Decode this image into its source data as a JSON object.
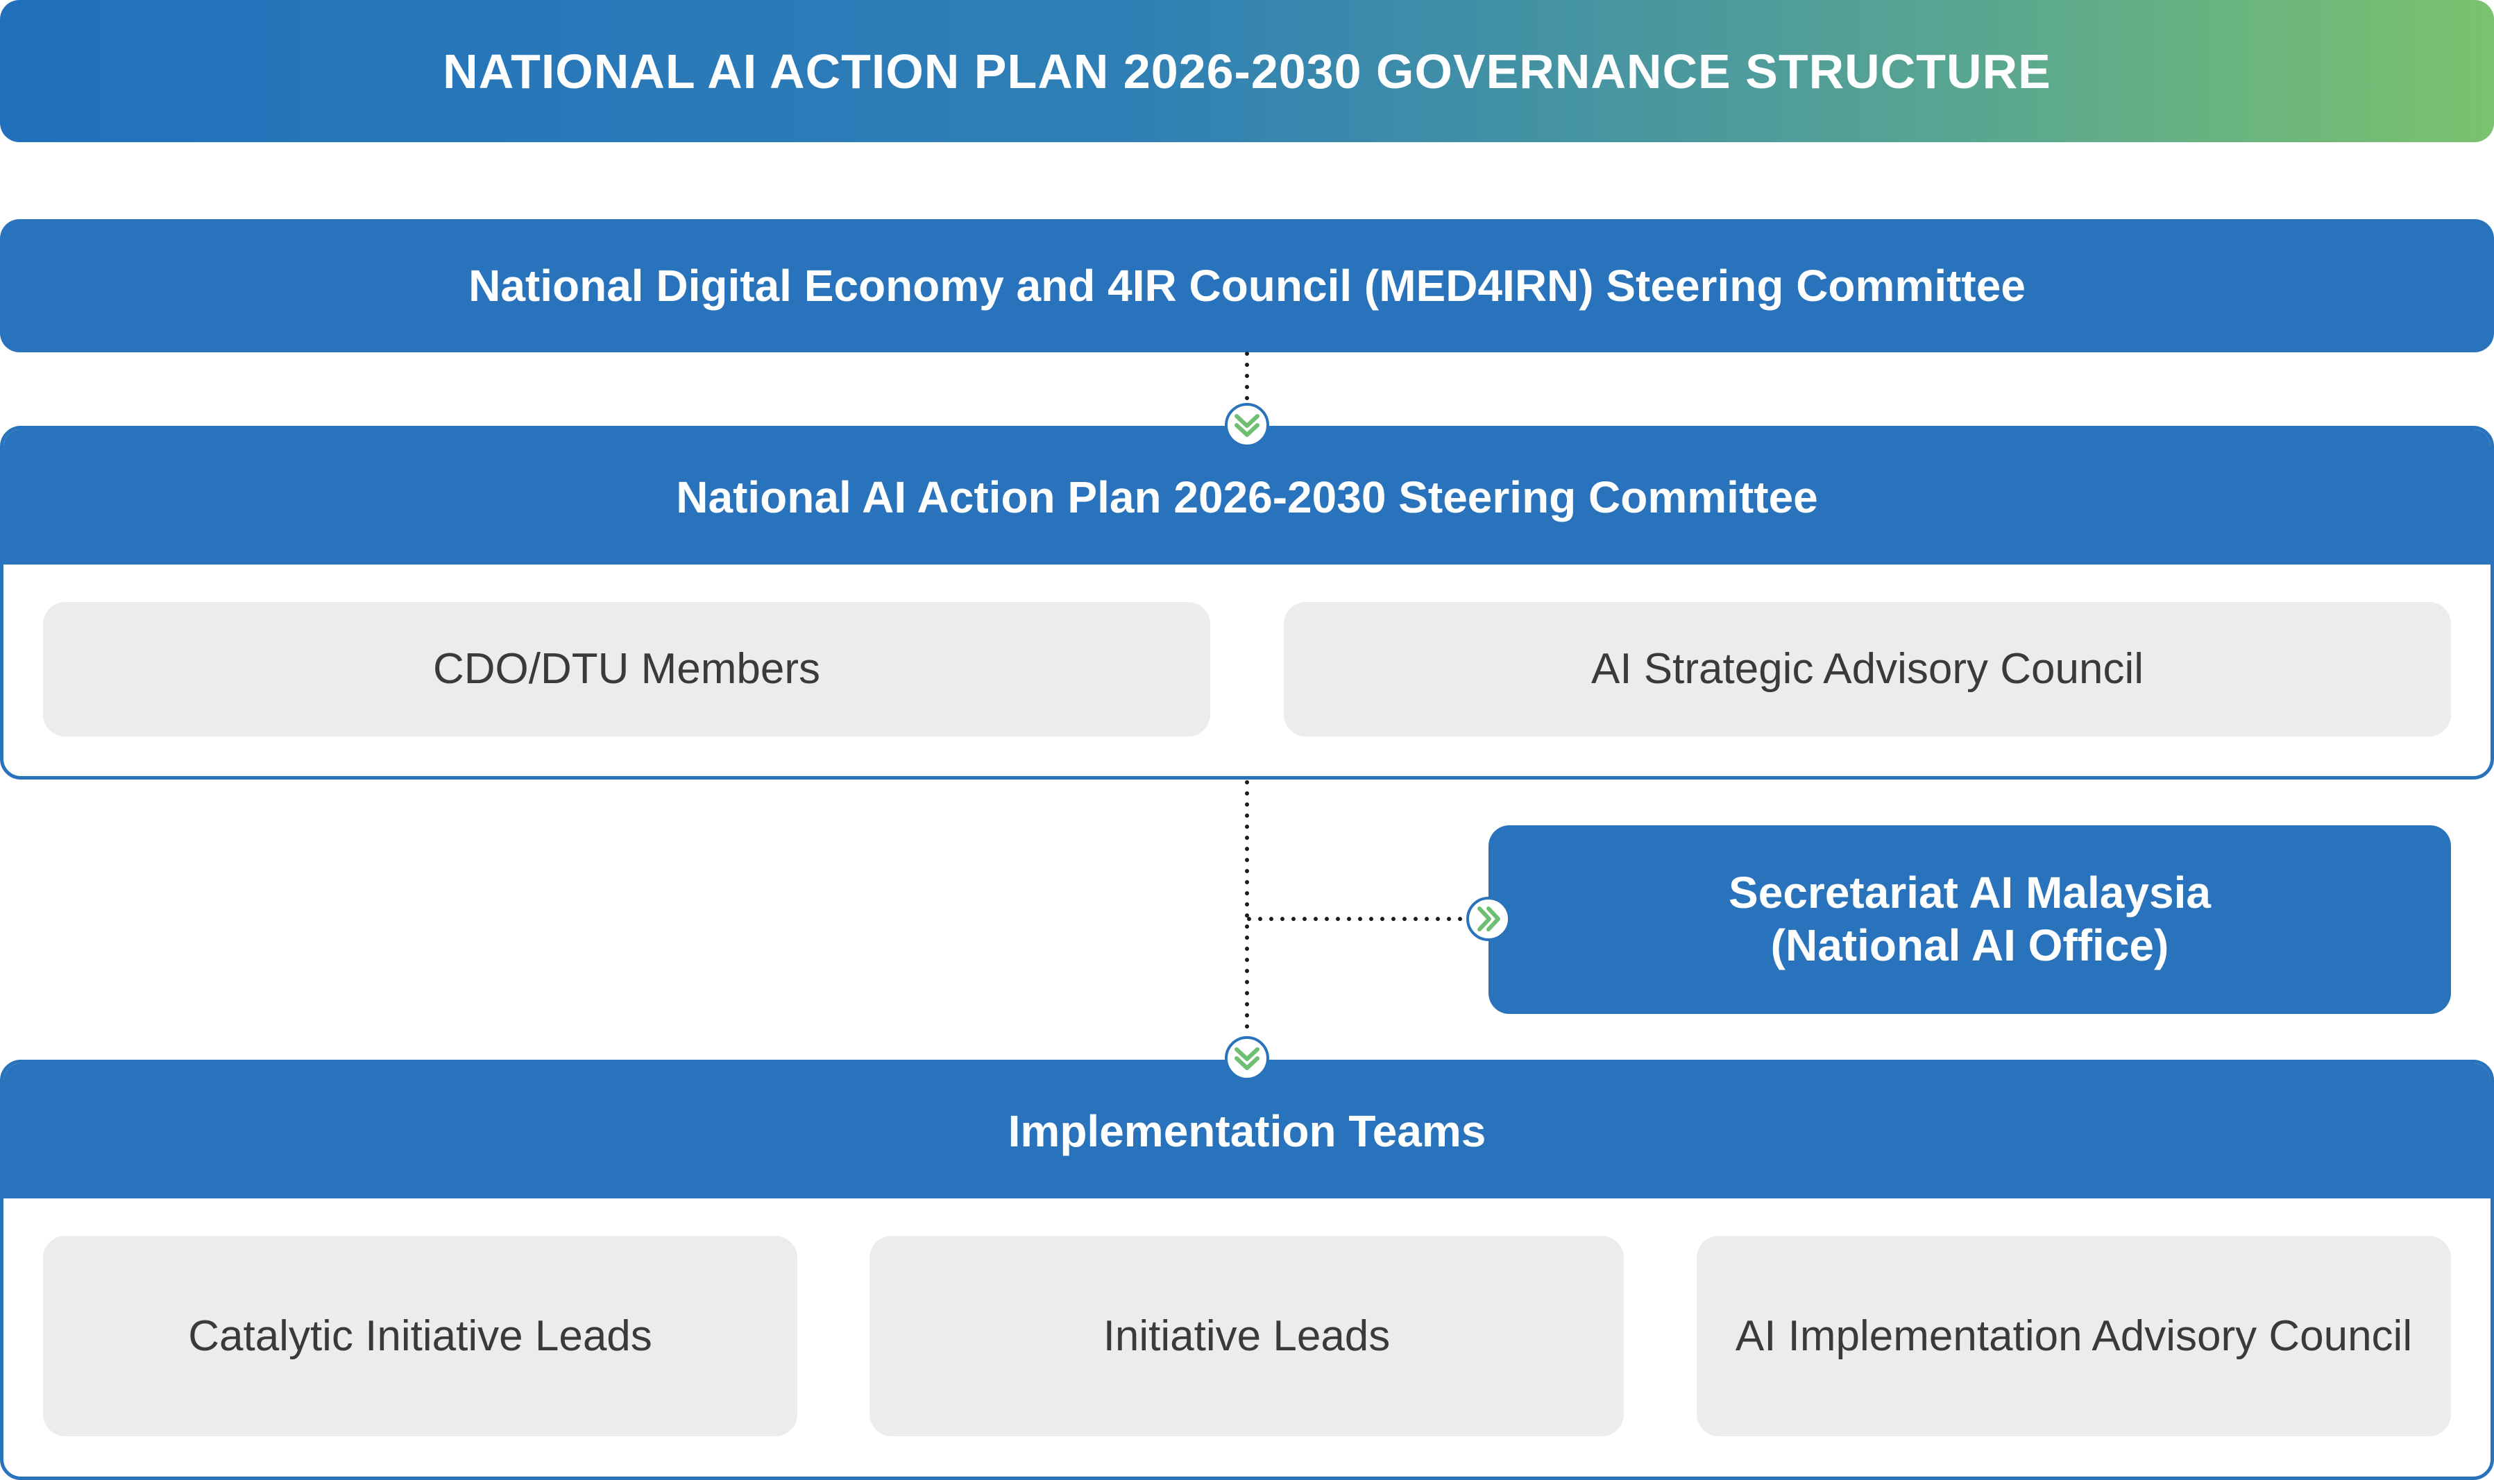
{
  "title": "NATIONAL AI ACTION PLAN 2026-2030 GOVERNANCE STRUCTURE",
  "council": {
    "label": "National Digital Economy and 4IR Council (MED4IRN) Steering Committee"
  },
  "steering": {
    "label": "National AI Action Plan 2026-2030 Steering Committee",
    "members": [
      "CDO/DTU Members",
      "AI Strategic Advisory Council"
    ]
  },
  "secretariat": {
    "line1": "Secretariat AI Malaysia",
    "line2": "(National AI Office)"
  },
  "implementation": {
    "label": "Implementation Teams",
    "members": [
      "Catalytic Initiative Leads",
      "Initiative Leads",
      "AI Implementation Advisory Council"
    ]
  },
  "colors": {
    "primary_blue": "#2873bb",
    "gradient_end_green": "#7bc26e",
    "box_grey": "#ececec",
    "chevron_green": "#6fbf73"
  }
}
